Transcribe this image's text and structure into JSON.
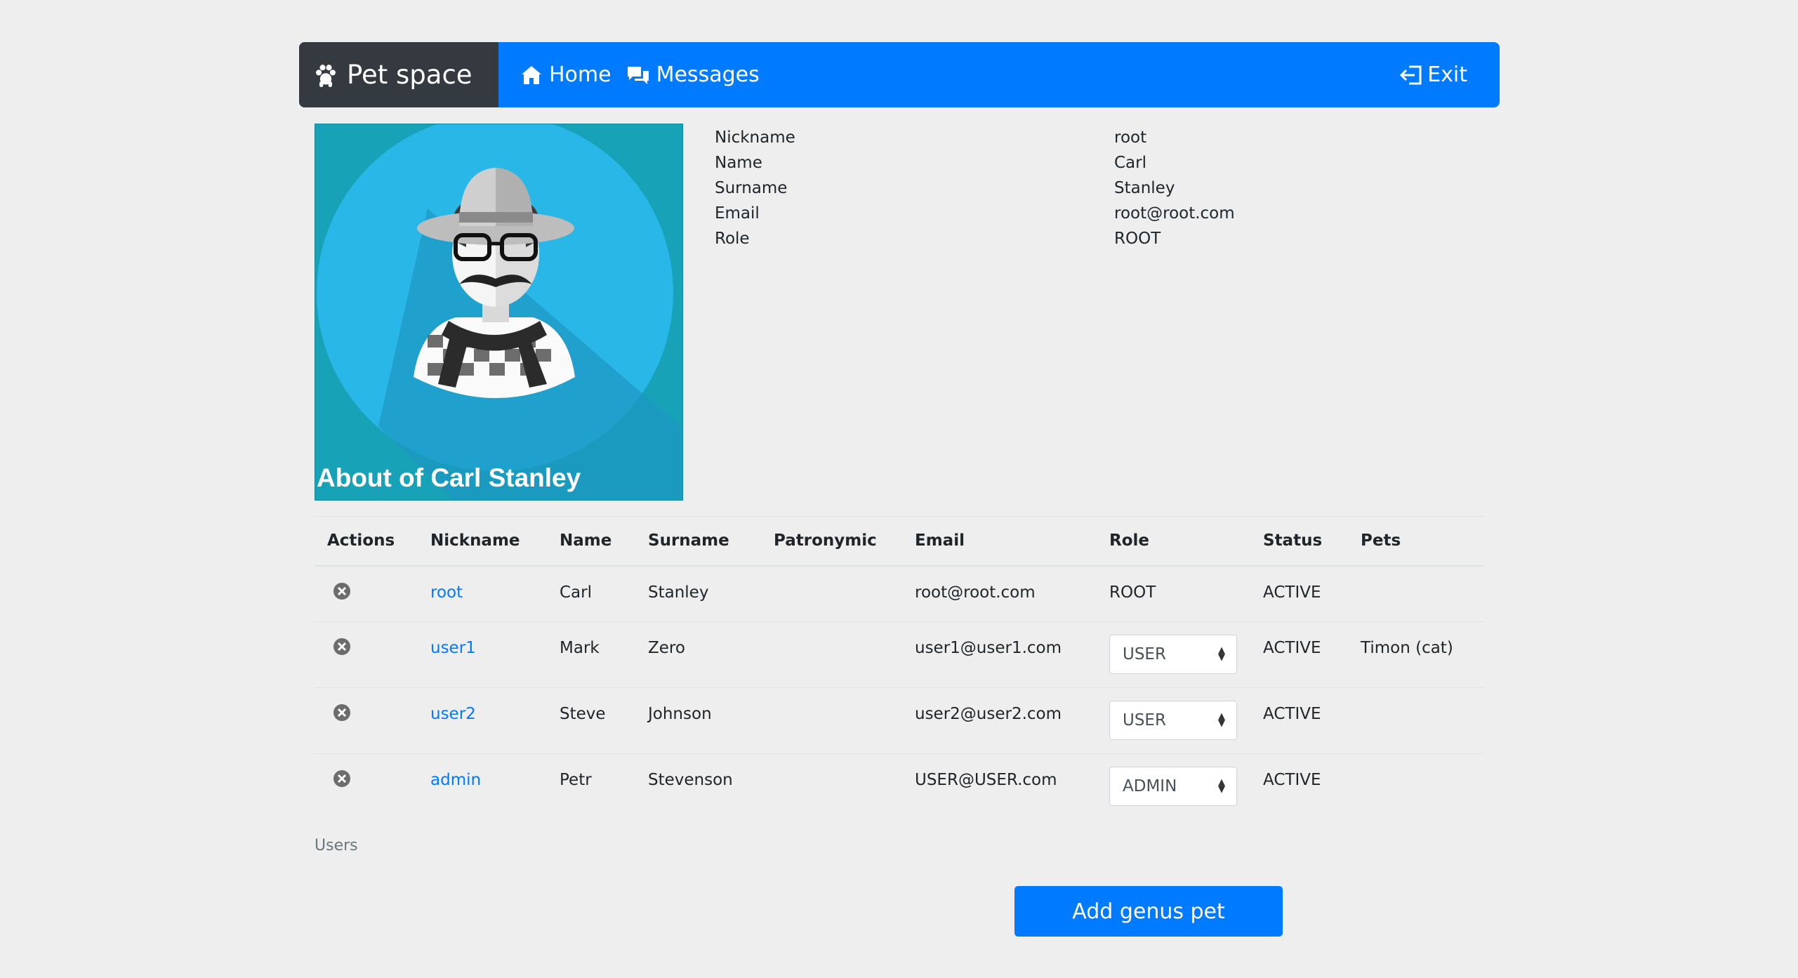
{
  "navbar": {
    "brand": "Pet space",
    "home_label": "Home",
    "messages_label": "Messages",
    "exit_label": "Exit"
  },
  "profile": {
    "caption": "About of Carl Stanley",
    "fields": [
      {
        "label": "Nickname",
        "value": "root"
      },
      {
        "label": "Name",
        "value": "Carl"
      },
      {
        "label": "Surname",
        "value": "Stanley"
      },
      {
        "label": "Email",
        "value": "root@root.com"
      },
      {
        "label": "Role",
        "value": "ROOT"
      }
    ]
  },
  "table": {
    "headers": [
      "Actions",
      "Nickname",
      "Name",
      "Surname",
      "Patronymic",
      "Email",
      "Role",
      "Status",
      "Pets"
    ],
    "rows": [
      {
        "nickname": "root",
        "name": "Carl",
        "surname": "Stanley",
        "patronymic": "",
        "email": "root@root.com",
        "role": "ROOT",
        "status": "ACTIVE",
        "pets": ""
      },
      {
        "nickname": "user1",
        "name": "Mark",
        "surname": "Zero",
        "patronymic": "",
        "email": "user1@user1.com",
        "role": "USER",
        "status": "ACTIVE",
        "pets": "Timon (cat)"
      },
      {
        "nickname": "user2",
        "name": "Steve",
        "surname": "Johnson",
        "patronymic": "",
        "email": "user2@user2.com",
        "role": "USER",
        "status": "ACTIVE",
        "pets": ""
      },
      {
        "nickname": "admin",
        "name": "Petr",
        "surname": "Stevenson",
        "patronymic": "",
        "email": "USER@USER.com",
        "role": "ADMIN",
        "status": "ACTIVE",
        "pets": ""
      }
    ],
    "caption": "Users"
  },
  "add_button_label": "Add genus pet",
  "colors": {
    "primary": "#007bff",
    "brand_bg": "#343a40",
    "avatar_bg": "#17a2b8"
  },
  "icons": [
    "paw-icon",
    "home-icon",
    "messages-icon",
    "exit-icon",
    "remove-icon"
  ]
}
